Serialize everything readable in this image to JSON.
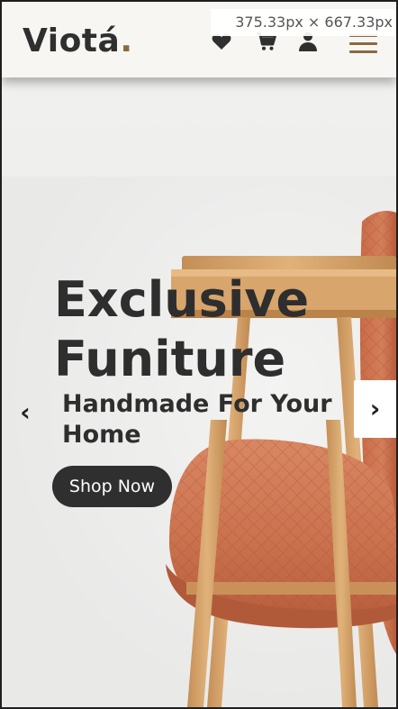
{
  "viewport_label": "375.33px × 667.33px",
  "header": {
    "logo_text": "Viotá",
    "logo_dot": ".",
    "icons": [
      "heart-icon",
      "cart-icon",
      "user-icon",
      "hamburger-menu-icon"
    ]
  },
  "hero": {
    "title_line1": "Exclusive",
    "title_line2": "Funiture",
    "subtitle_line1": "Handmade For Your",
    "subtitle_line2": "Home",
    "cta_label": "Shop Now",
    "prev_arrow": "‹",
    "next_arrow": "›"
  },
  "colors": {
    "accent": "#8a6a3f",
    "dark": "#2f2f2f",
    "header_bg": "#f7f6f2",
    "hero_bg": "#ededeb",
    "chair_fabric": "#c9704e",
    "chair_wood": "#d4a26a"
  }
}
